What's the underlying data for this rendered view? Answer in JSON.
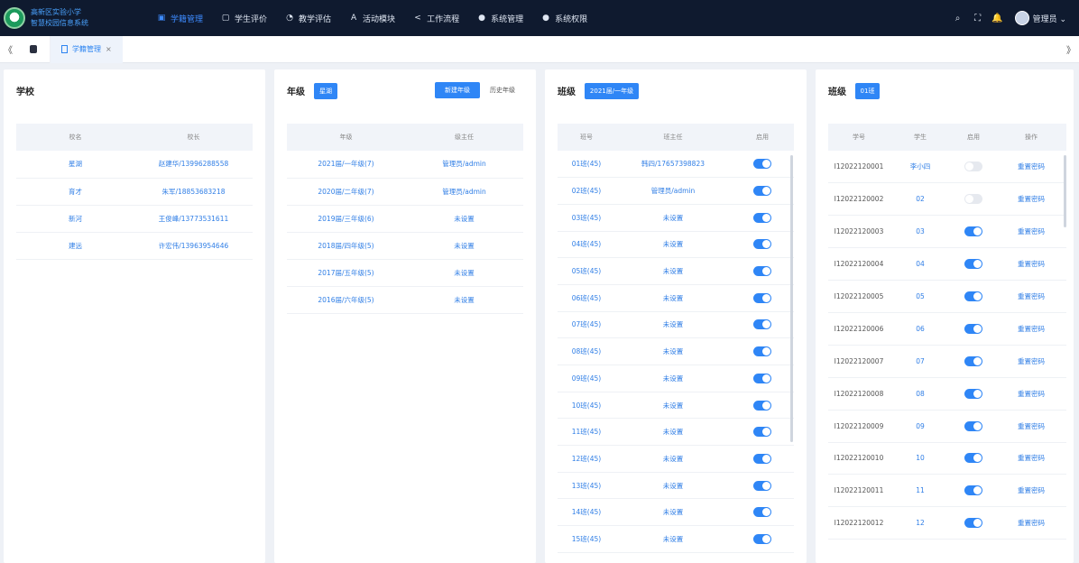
{
  "brand": {
    "line1": "高新区实验小学",
    "line2": "智慧校园信息系统"
  },
  "nav": [
    {
      "label": "学籍管理",
      "icon": "▣",
      "active": true
    },
    {
      "label": "学生评价",
      "icon": "▢"
    },
    {
      "label": "教学评估",
      "icon": "◔"
    },
    {
      "label": "活动模块",
      "icon": "A"
    },
    {
      "label": "工作流程",
      "icon": "<"
    },
    {
      "label": "系统管理",
      "icon": "●"
    },
    {
      "label": "系统权限",
      "icon": "●"
    }
  ],
  "user": {
    "name": "管理员"
  },
  "tabs": {
    "active_label": "学籍管理",
    "close": "×",
    "prev": "《",
    "next": "》"
  },
  "school_panel": {
    "title": "学校",
    "headers": [
      "校名",
      "校长"
    ],
    "rows": [
      [
        "星湖",
        "赵建华/13996288558"
      ],
      [
        "育才",
        "朱军/18853683218"
      ],
      [
        "新河",
        "王俊峰/13773531611"
      ],
      [
        "建远",
        "许宏伟/13963954646"
      ]
    ]
  },
  "grade_panel": {
    "title": "年级",
    "tag": "星湖",
    "buttons": [
      "新建年级",
      "历史年级"
    ],
    "headers": [
      "年级",
      "级主任"
    ],
    "rows": [
      [
        "2021届/一年级(7)",
        "管理员/admin"
      ],
      [
        "2020届/二年级(7)",
        "管理员/admin"
      ],
      [
        "2019届/三年级(6)",
        "未设置"
      ],
      [
        "2018届/四年级(5)",
        "未设置"
      ],
      [
        "2017届/五年级(5)",
        "未设置"
      ],
      [
        "2016届/六年级(5)",
        "未设置"
      ]
    ]
  },
  "class_panel": {
    "title": "班级",
    "tag": "2021届/一年级",
    "headers": [
      "班号",
      "班主任",
      "启用"
    ],
    "rows": [
      [
        "01班(45)",
        "韩四/17657398823",
        true
      ],
      [
        "02班(45)",
        "管理员/admin",
        true
      ],
      [
        "03班(45)",
        "未设置",
        true
      ],
      [
        "04班(45)",
        "未设置",
        true
      ],
      [
        "05班(45)",
        "未设置",
        true
      ],
      [
        "06班(45)",
        "未设置",
        true
      ],
      [
        "07班(45)",
        "未设置",
        true
      ],
      [
        "08班(45)",
        "未设置",
        true
      ],
      [
        "09班(45)",
        "未设置",
        true
      ],
      [
        "10班(45)",
        "未设置",
        true
      ],
      [
        "11班(45)",
        "未设置",
        true
      ],
      [
        "12班(45)",
        "未设置",
        true
      ],
      [
        "13班(45)",
        "未设置",
        true
      ],
      [
        "14班(45)",
        "未设置",
        true
      ],
      [
        "15班(45)",
        "未设置",
        true
      ]
    ]
  },
  "student_panel": {
    "title": "班级",
    "tag": "01班",
    "headers": [
      "学号",
      "学生",
      "启用",
      "操作"
    ],
    "rows": [
      [
        "I12022120001",
        "李小四",
        false,
        "重置密码"
      ],
      [
        "I12022120002",
        "02",
        false,
        "重置密码"
      ],
      [
        "I12022120003",
        "03",
        true,
        "重置密码"
      ],
      [
        "I12022120004",
        "04",
        true,
        "重置密码"
      ],
      [
        "I12022120005",
        "05",
        true,
        "重置密码"
      ],
      [
        "I12022120006",
        "06",
        true,
        "重置密码"
      ],
      [
        "I12022120007",
        "07",
        true,
        "重置密码"
      ],
      [
        "I12022120008",
        "08",
        true,
        "重置密码"
      ],
      [
        "I12022120009",
        "09",
        true,
        "重置密码"
      ],
      [
        "I12022120010",
        "10",
        true,
        "重置密码"
      ],
      [
        "I12022120011",
        "11",
        true,
        "重置密码"
      ],
      [
        "I12022120012",
        "12",
        true,
        "重置密码"
      ]
    ]
  }
}
